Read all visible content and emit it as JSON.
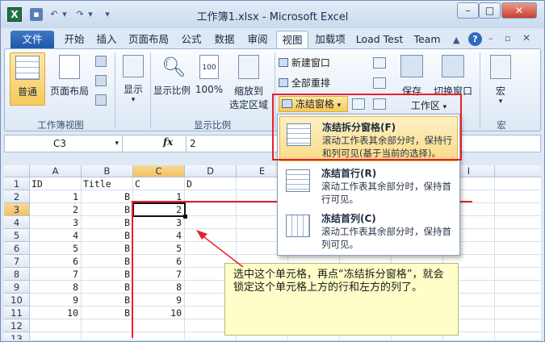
{
  "window": {
    "title": "工作簿1.xlsx - Microsoft Excel",
    "app_letter": "X",
    "min_label": "–",
    "max_label": "□",
    "close_label": "✕"
  },
  "tabs": [
    "文件",
    "开始",
    "插入",
    "页面布局",
    "公式",
    "数据",
    "审阅",
    "视图",
    "加载项",
    "Load Test",
    "Team"
  ],
  "ribbon": {
    "workbook_views": {
      "label": "工作簿视图",
      "normal": "普通",
      "page_layout": "页面布局"
    },
    "show": {
      "label": "显示"
    },
    "zoom": {
      "label": "显示比例",
      "zoom": "显示比例",
      "hundred": "100%",
      "zoom_sel_1": "缩放到",
      "zoom_sel_2": "选定区域"
    },
    "window": {
      "new_window": "新建窗口",
      "arrange_all": "全部重排",
      "freeze": "冻结窗格",
      "save": "保存",
      "switch": "切换窗口",
      "workspace": "工作区"
    },
    "macros": {
      "label": "宏",
      "macro": "宏"
    }
  },
  "formula_bar": {
    "name_box": "C3",
    "fx": "fx",
    "value": "2"
  },
  "columns": [
    "A",
    "B",
    "C",
    "D",
    "E",
    "",
    "",
    "",
    "I",
    ""
  ],
  "rows": [
    "1",
    "2",
    "3",
    "4",
    "5",
    "6",
    "7",
    "8",
    "9",
    "10",
    "11",
    "12",
    "13"
  ],
  "cells": {
    "header": [
      "ID",
      "Title",
      "C",
      "D"
    ],
    "a_values": [
      "1",
      "2",
      "3",
      "4",
      "5",
      "6",
      "7",
      "8",
      "9",
      "10"
    ],
    "b_values": [
      "B",
      "B",
      "B",
      "B",
      "B",
      "B",
      "B",
      "B",
      "B",
      "B"
    ],
    "c_values": [
      "1",
      "2",
      "3",
      "4",
      "5",
      "6",
      "7",
      "8",
      "9",
      "10"
    ]
  },
  "dropdown": {
    "items": [
      {
        "title": "冻结拆分窗格(F)",
        "desc": "滚动工作表其余部分时，保持行和列可见(基于当前的选择)。"
      },
      {
        "title": "冻结首行(R)",
        "desc": "滚动工作表其余部分时，保持首行可见。"
      },
      {
        "title": "冻结首列(C)",
        "desc": "滚动工作表其余部分时，保持首列可见。"
      }
    ]
  },
  "callout": {
    "text": "选中这个单元格，再点“冻结拆分窗格”，就会锁定这个单元格上方的行和左方的列了。"
  },
  "colors": {
    "highlight": "#e8202a",
    "accent": "#1e58a7",
    "selected_item": "#fde9a6"
  }
}
